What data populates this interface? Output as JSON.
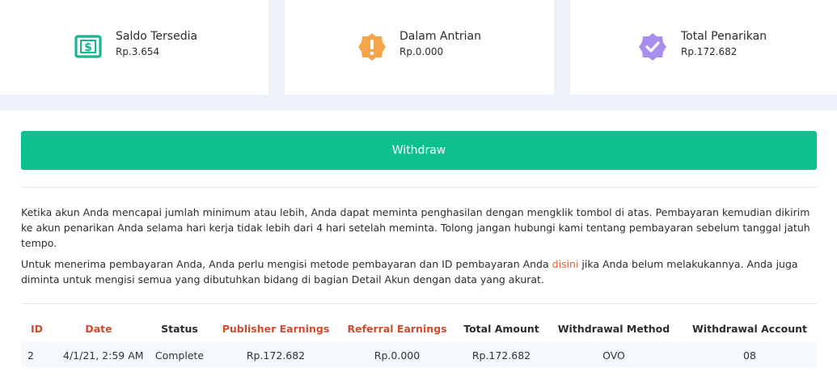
{
  "cards": [
    {
      "label": "Saldo Tersedia",
      "value": "Rp.3.654",
      "icon": "dollar-bill-icon",
      "color": "#1ab394"
    },
    {
      "label": "Dalam Antrian",
      "value": "Rp.0.000",
      "icon": "alert-badge-icon",
      "color": "#f7a54a"
    },
    {
      "label": "Total Penarikan",
      "value": "Rp.172.682",
      "icon": "verified-badge-icon",
      "color": "#a98ef0"
    }
  ],
  "withdraw_button": {
    "label": "Withdraw",
    "color": "#0cc18f"
  },
  "info": {
    "paragraph1": "Ketika akun Anda mencapai jumlah minimum atau lebih, Anda dapat meminta penghasilan dengan mengklik tombol di atas. Pembayaran kemudian dikirim ke akun penarikan Anda selama hari kerja tidak lebih dari 4 hari setelah meminta. Tolong jangan hubungi kami tentang pembayaran sebelum tanggal jatuh tempo.",
    "paragraph2_before": "Untuk menerima pembayaran Anda, Anda perlu mengisi metode pembayaran dan ID pembayaran Anda ",
    "paragraph2_link": "disini",
    "paragraph2_after": " jika Anda belum melakukannya. Anda juga diminta untuk mengisi semua yang dibutuhkan bidang di bagian Detail Akun dengan data yang akurat."
  },
  "table": {
    "headers": [
      "ID",
      "Date",
      "Status",
      "Publisher Earnings",
      "Referral Earnings",
      "Total Amount",
      "Withdrawal Method",
      "Withdrawal Account"
    ],
    "rows": [
      [
        "2",
        "4/1/21, 2:59 AM",
        "Complete",
        "Rp.172.682",
        "Rp.0.000",
        "Rp.172.682",
        "OVO",
        "08"
      ]
    ]
  }
}
